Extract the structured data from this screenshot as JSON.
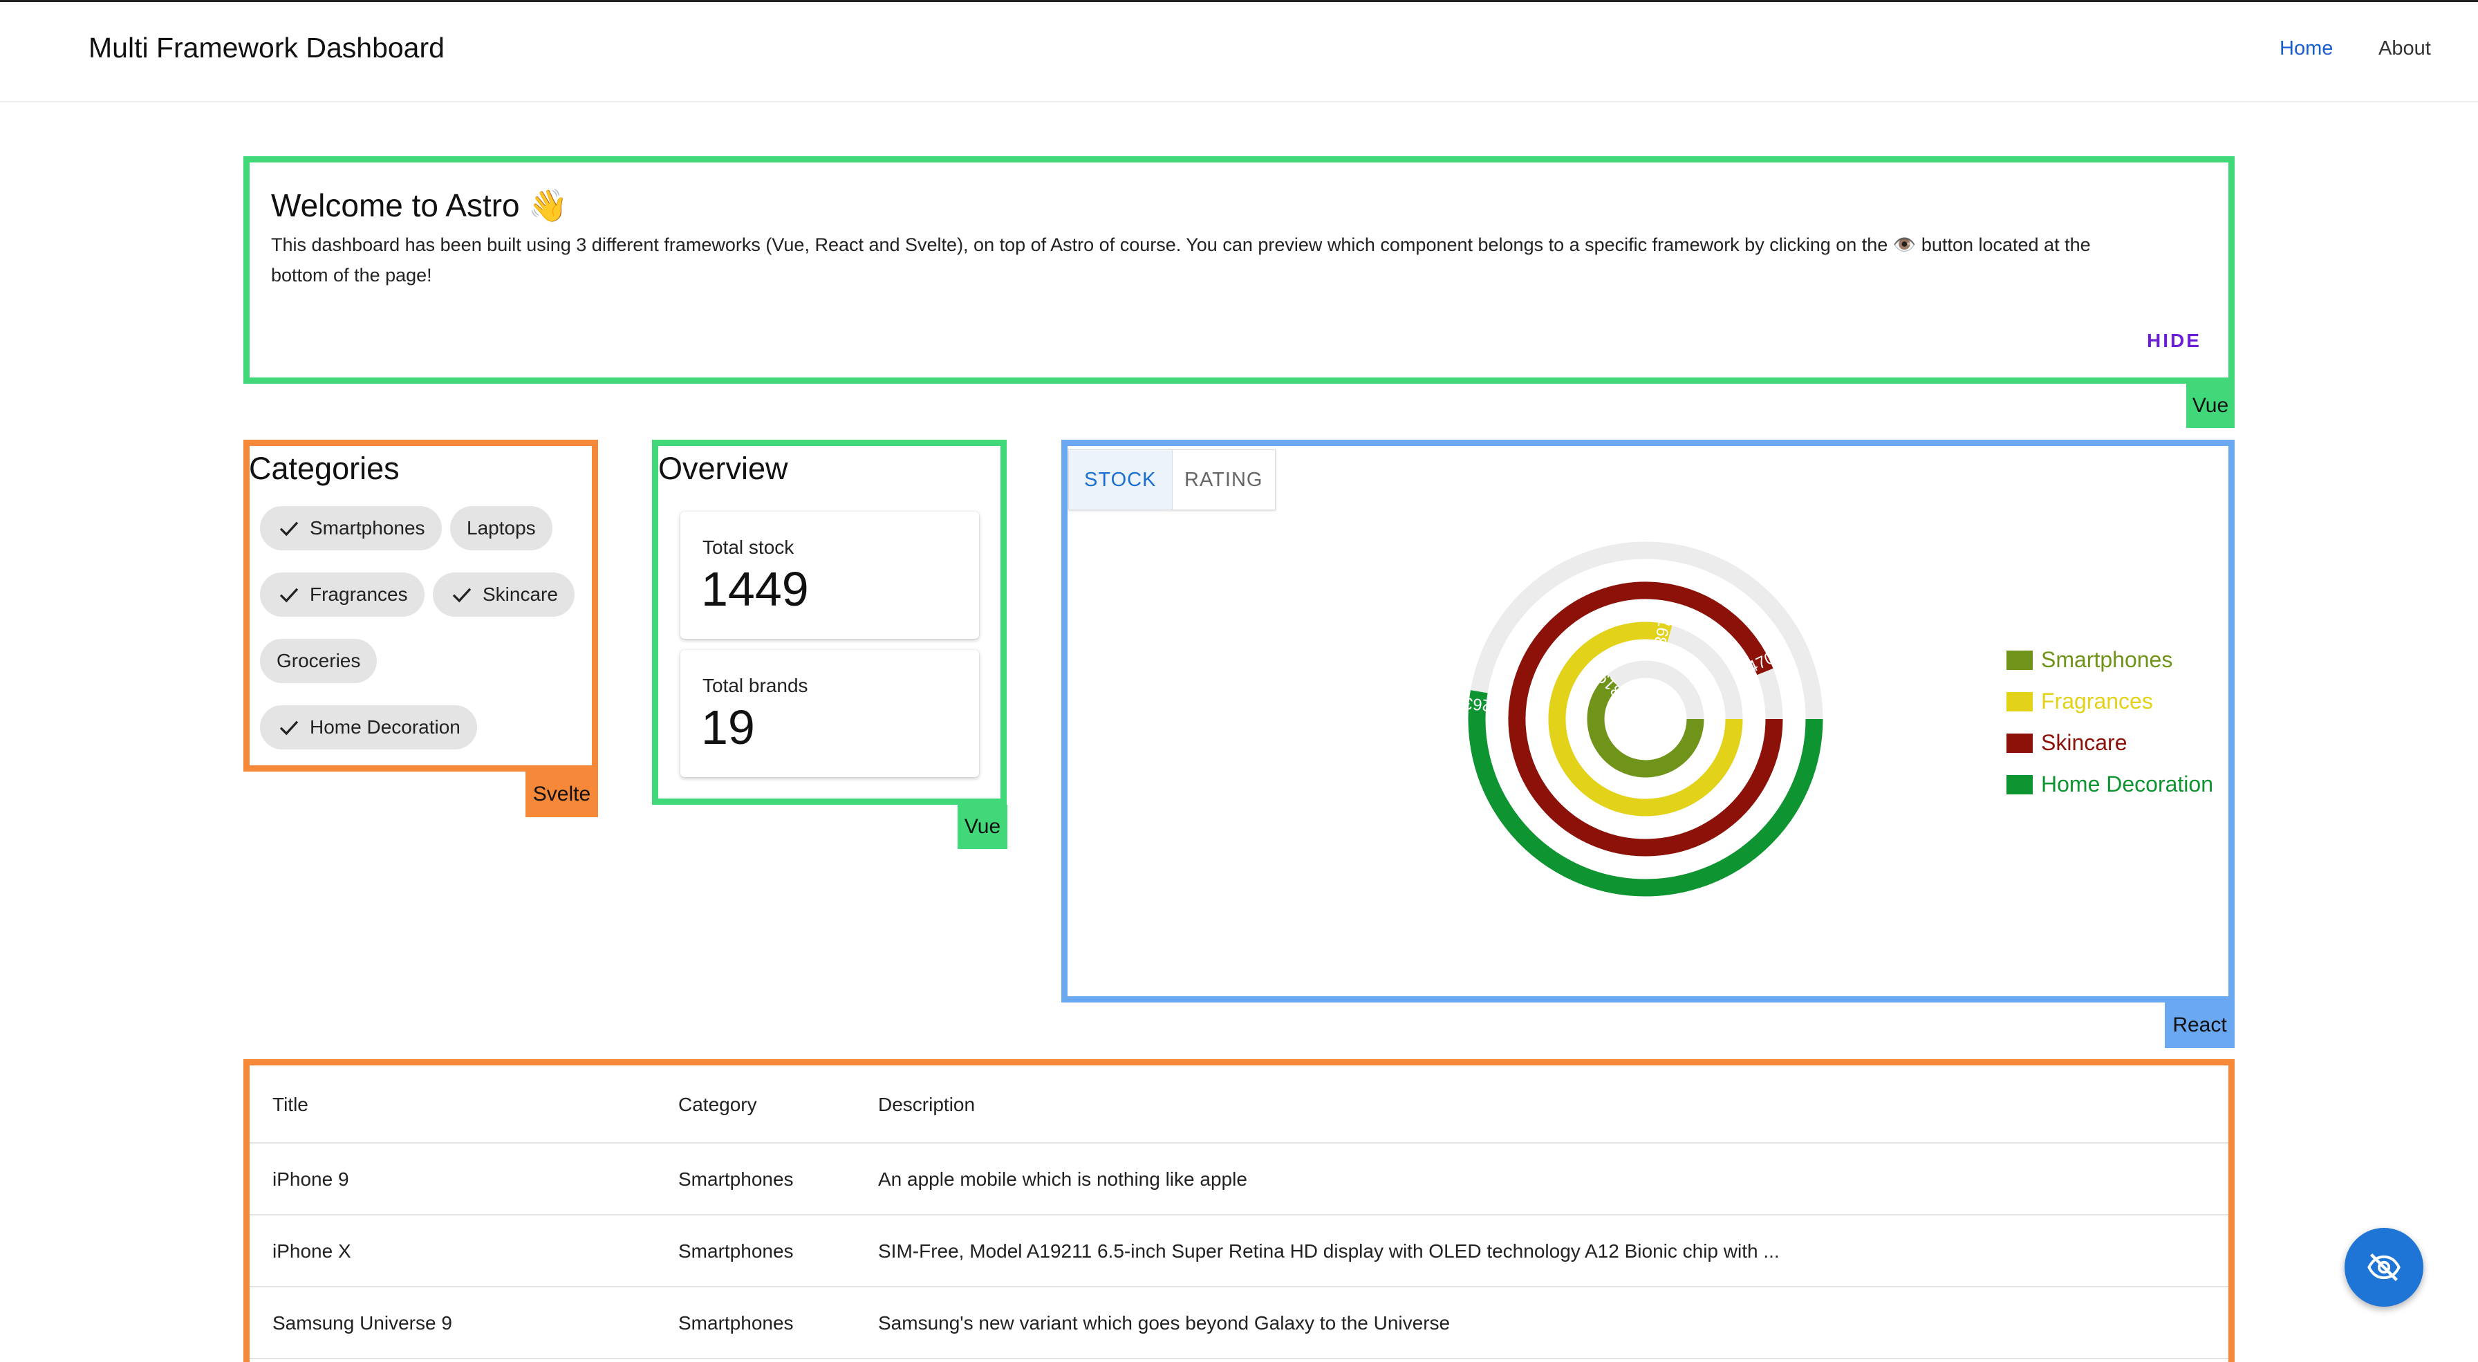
{
  "header": {
    "app_title": "Multi Framework Dashboard",
    "nav": {
      "home": "Home",
      "about": "About"
    }
  },
  "welcome": {
    "title": "Welcome to Astro 👋",
    "text": "This dashboard has been built using 3 different frameworks (Vue, React and Svelte), on top of Astro of course. You can preview which component belongs to a specific framework by clicking on the 👁️ button located at the bottom of the page!",
    "hide_label": "HIDE",
    "framework": "Vue"
  },
  "categories": {
    "title": "Categories",
    "framework": "Svelte",
    "chips": [
      {
        "label": "Smartphones",
        "selected": true
      },
      {
        "label": "Laptops",
        "selected": false
      },
      {
        "label": "Fragrances",
        "selected": true
      },
      {
        "label": "Skincare",
        "selected": true
      },
      {
        "label": "Groceries",
        "selected": false
      },
      {
        "label": "Home Decoration",
        "selected": true
      }
    ]
  },
  "overview": {
    "title": "Overview",
    "framework": "Vue",
    "total_stock_label": "Total stock",
    "total_stock_value": "1449",
    "total_brands_label": "Total brands",
    "total_brands_value": "19"
  },
  "chart_panel": {
    "framework": "React",
    "tabs": {
      "stock": "STOCK",
      "rating": "RATING"
    },
    "active_tab": "STOCK"
  },
  "chart_data": {
    "type": "radial-bar",
    "series": [
      {
        "name": "Smartphones",
        "value": 319,
        "color": "#6f9419"
      },
      {
        "name": "Fragrances",
        "value": 397,
        "color": "#e3d21a"
      },
      {
        "name": "Skincare",
        "value": 470,
        "color": "#8b1109"
      },
      {
        "name": "Home Decoration",
        "value": 263,
        "color": "#0e9430"
      }
    ],
    "max": 500,
    "track_color": "#ececec",
    "legend_position": "right"
  },
  "products_table": {
    "framework": "Svelte",
    "columns": [
      "Title",
      "Category",
      "Description"
    ],
    "rows": [
      [
        "iPhone 9",
        "Smartphones",
        "An apple mobile which is nothing like apple"
      ],
      [
        "iPhone X",
        "Smartphones",
        "SIM-Free, Model A19211 6.5-inch Super Retina HD display with OLED technology A12 Bionic chip with ..."
      ],
      [
        "Samsung Universe 9",
        "Smartphones",
        "Samsung's new variant which goes beyond Galaxy to the Universe"
      ]
    ]
  },
  "fab": {
    "icon": "eye-off-icon"
  }
}
